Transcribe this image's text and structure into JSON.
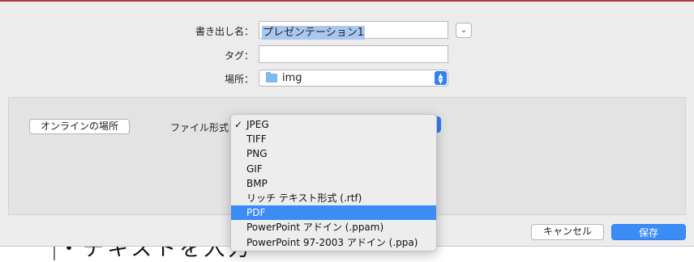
{
  "dialog": {
    "export_label": "書き出し名：",
    "export_name": "プレゼンテーション1",
    "tag_label": "タグ：",
    "tag_value": "",
    "location_label": "場所：",
    "location_value": "img",
    "online_button": "オンラインの場所",
    "format_label": "ファイル形式",
    "cancel_button": "キャンセル",
    "save_button": "保存"
  },
  "format_menu": {
    "checked_mark": "✓",
    "items": [
      {
        "label": "JPEG",
        "checked": true,
        "highlighted": false
      },
      {
        "label": "TIFF",
        "checked": false,
        "highlighted": false
      },
      {
        "label": "PNG",
        "checked": false,
        "highlighted": false
      },
      {
        "label": "GIF",
        "checked": false,
        "highlighted": false
      },
      {
        "label": "BMP",
        "checked": false,
        "highlighted": false
      },
      {
        "label": "リッチ テキスト形式 (.rtf)",
        "checked": false,
        "highlighted": false
      },
      {
        "label": "PDF",
        "checked": false,
        "highlighted": true
      },
      {
        "label": "PowerPoint アドイン (.ppam)",
        "checked": false,
        "highlighted": false
      },
      {
        "label": "PowerPoint 97-2003 アドイン (.ppa)",
        "checked": false,
        "highlighted": false
      }
    ]
  },
  "background": {
    "doc_text": "・テキストを入力"
  },
  "colors": {
    "accent": "#3c8cf6",
    "selection": "#a9c8f0"
  }
}
